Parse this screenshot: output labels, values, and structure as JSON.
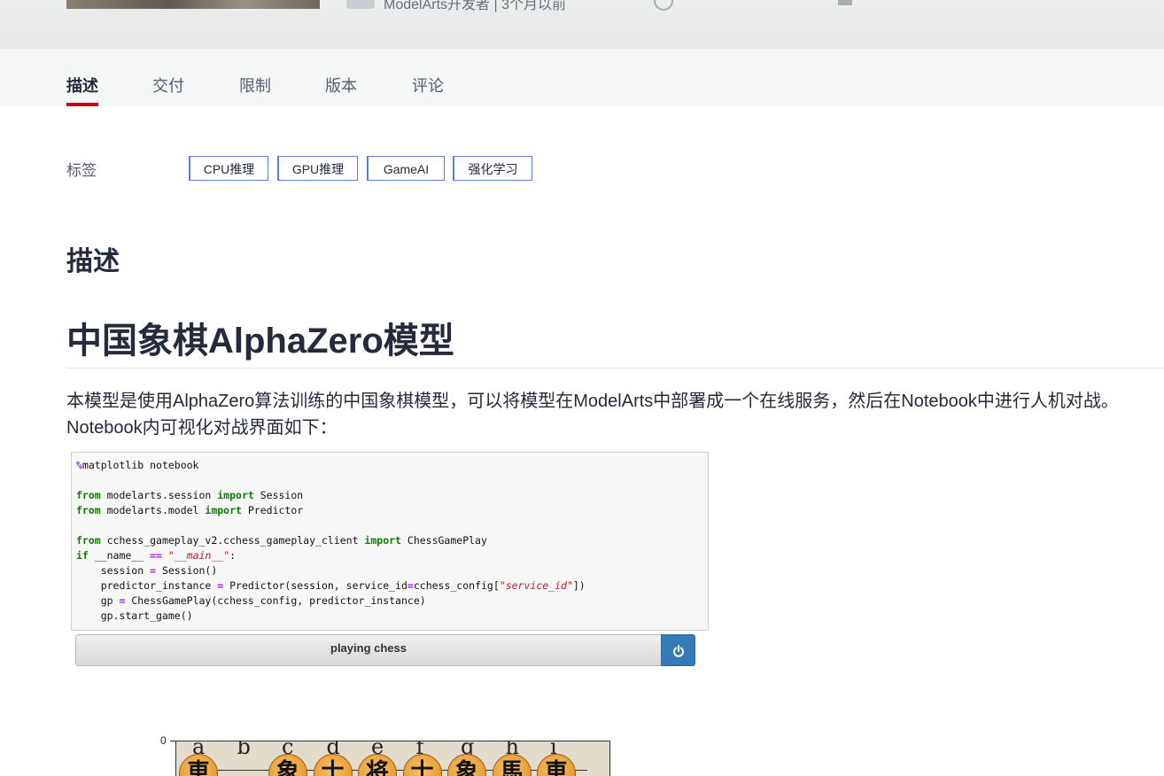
{
  "header": {
    "partial_text": "ModelArts开发者  |  3个月以前"
  },
  "tabs": [
    {
      "label": "描述",
      "active": true
    },
    {
      "label": "交付"
    },
    {
      "label": "限制"
    },
    {
      "label": "版本"
    },
    {
      "label": "评论"
    }
  ],
  "tags": {
    "label": "标签",
    "items": [
      "CPU推理",
      "GPU推理",
      "GameAI",
      "强化学习"
    ]
  },
  "section_heading": "描述",
  "article": {
    "title": "中国象棋AlphaZero模型",
    "paragraph": "本模型是使用AlphaZero算法训练的中国象棋模型，可以将模型在ModelArts中部署成一个在线服务，然后在Notebook中进行人机对战。\nNotebook内可视化对战界面如下："
  },
  "notebook": {
    "code_lines": [
      "%matplotlib notebook",
      "",
      "from modelarts.session import Session",
      "from modelarts.model import Predictor",
      "",
      "from cchess_gameplay_v2.cchess_gameplay_client import ChessGamePlay",
      "if __name__ == \"__main__\":",
      "    session = Session()",
      "    predictor_instance = Predictor(session, service_id=cchess_config[\"service_id\"])",
      "    gp = ChessGamePlay(cchess_config, predictor_instance)",
      "    gp.start_game()"
    ],
    "button_label": "playing chess",
    "power_icon": "power-icon"
  },
  "board": {
    "axis_zero": "0",
    "files": [
      "a",
      "b",
      "c",
      "d",
      "e",
      "f",
      "g",
      "h",
      "i"
    ],
    "pieces": [
      "車",
      "",
      "象",
      "士",
      "将",
      "士",
      "象",
      "馬",
      "車"
    ]
  },
  "colors": {
    "active_tab_underline": "#c7000b",
    "tag_border": "#5e7ce0",
    "power_button": "#337ab7",
    "piece": "#e69a2e"
  }
}
